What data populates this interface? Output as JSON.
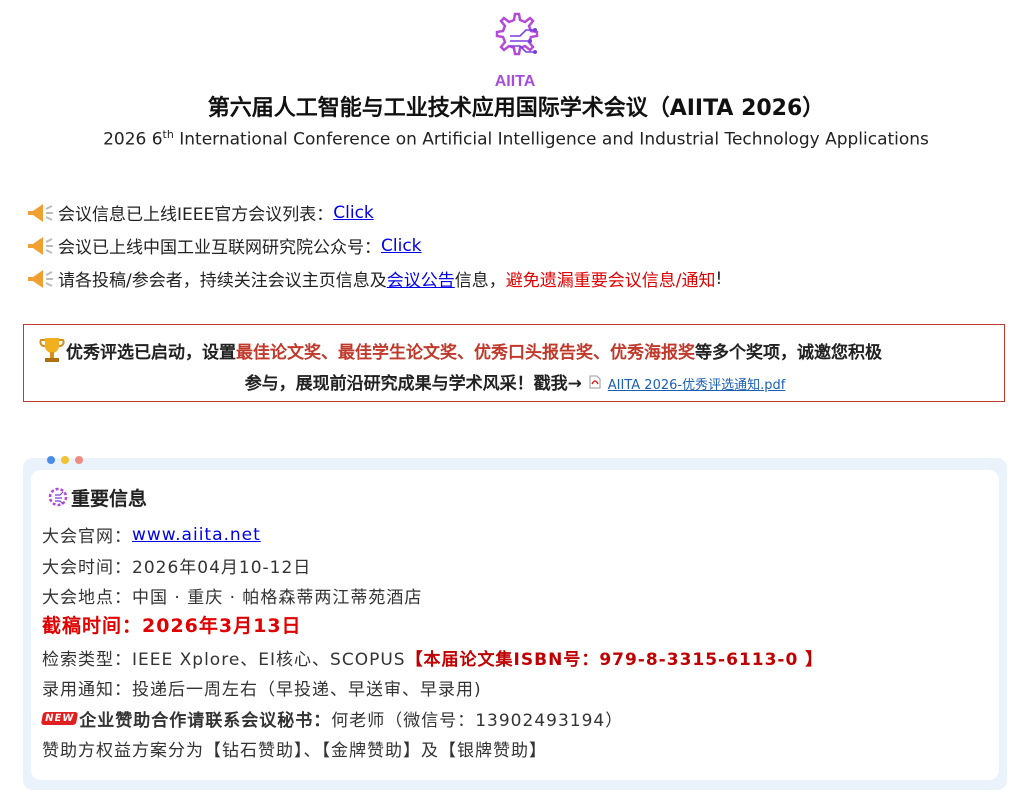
{
  "header": {
    "logo_text": "AIITA",
    "title_cn": "第六届人工智能与工业技术应用国际学术会议（AIITA 2026）",
    "title_en_prefix": "2026 6",
    "title_en_sup": "th",
    "title_en_suffix": " International Conference on Artificial Intelligence and Industrial Technology Applications"
  },
  "notices": [
    {
      "text": "会议信息已上线IEEE官方会议列表：",
      "link": "Click "
    },
    {
      "text": "会议已上线中国工业互联网研究院公众号：",
      "link": "Click"
    },
    {
      "text_before": "请各投稿/参会者，持续关注会议主页信息及",
      "link": "会议公告",
      "text_mid": "信息，",
      "text_red": "避免遗漏重要会议信息/通知",
      "text_end": "!"
    }
  ],
  "award": {
    "prefix": "优秀评选已启动，设置",
    "highlight": "最佳论文奖、最佳学生论文奖、优秀口头报告奖、优秀海报奖",
    "suffix": "等多个奖项，诚邀您积极",
    "line2": "参与，展现前沿研究成果与学术风采！戳我→",
    "file_link": "AIITA 2026-优秀评选通知.pdf"
  },
  "info": {
    "title": "重要信息",
    "website_label": "大会官网：",
    "website_link": "www.aiita.net ",
    "time": "大会时间：2026年04月10-12日",
    "venue": "大会地点：中国 · 重庆 · 帕格森蒂两江蒂苑酒店",
    "deadline": "截稿时间：2026年3月13日",
    "index_label": "检索类型：IEEE Xplore、EI核心、SCOPUS",
    "isbn": "【本届论文集ISBN号：979-8-3315-6113-0 】",
    "notice": "录用通知：投递后一周左右（早投递、早送审、早录用)",
    "new_badge": "NEW",
    "sponsor_bold": "企业赞助合作请联系会议秘书：",
    "sponsor_contact": "何老师（微信号：13902493194）",
    "sponsor_plans": "赞助方权益方案分为【钻石赞助】、【金牌赞助】及【银牌赞助】"
  },
  "colors": {
    "accent_red": "#e00000",
    "award_border": "#c0392b",
    "link_blue": "#0000ee",
    "panel_bg": "#eaf2fc",
    "dot_blue": "#4a8de8",
    "dot_yellow": "#f2c230",
    "dot_red": "#ee8a80"
  },
  "icons": [
    "logo-gear-icon",
    "megaphone-icon",
    "trophy-icon",
    "pdf-icon",
    "new-badge-icon"
  ]
}
